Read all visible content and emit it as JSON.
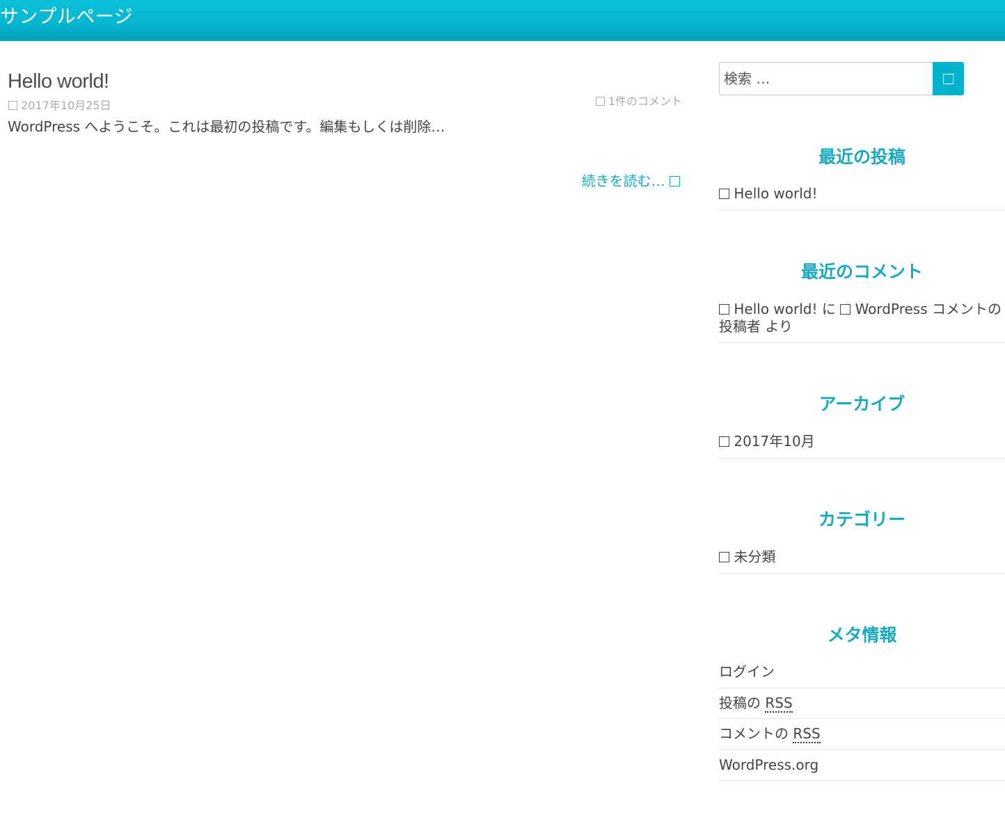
{
  "header": {
    "title": "サンプルページ"
  },
  "post": {
    "title": "Hello world!",
    "date": "2017年10月25日",
    "comments": "1件のコメント",
    "excerpt": "WordPress へようこそ。これは最初の投稿です。編集もしくは削除…",
    "read_more": "続きを読む…"
  },
  "sidebar": {
    "search": {
      "placeholder": "検索 …"
    },
    "recent_posts": {
      "title": "最近の投稿",
      "items": [
        "Hello world!"
      ]
    },
    "recent_comments": {
      "title": "最近のコメント",
      "post": "Hello world!",
      "joiner": "に",
      "author": "WordPress コメントの投稿者",
      "suffix": "より"
    },
    "archives": {
      "title": "アーカイブ",
      "items": [
        "2017年10月"
      ]
    },
    "categories": {
      "title": "カテゴリー",
      "items": [
        "未分類"
      ]
    },
    "meta": {
      "title": "メタ情報",
      "login": "ログイン",
      "posts_rss_prefix": "投稿の",
      "comments_rss_prefix": "コメントの",
      "rss": "RSS",
      "wordpress_org": "WordPress.org"
    }
  },
  "colors": {
    "accent": "#1aa9bf",
    "header": "#05b6cf"
  }
}
